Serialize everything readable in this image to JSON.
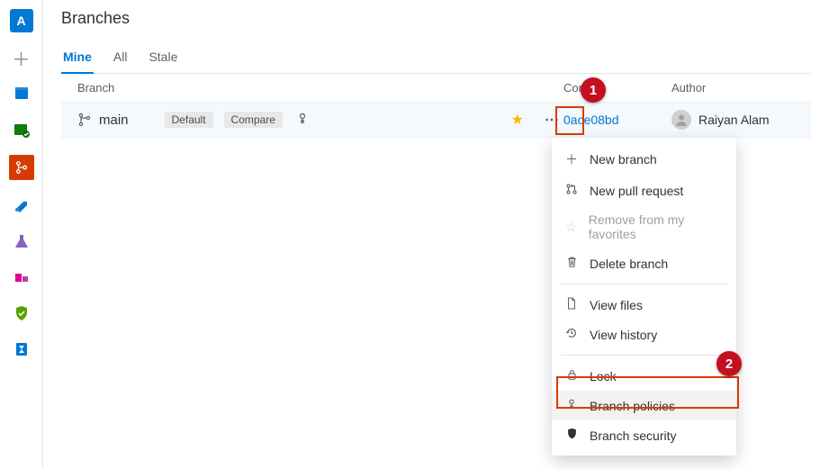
{
  "page": {
    "title": "Branches"
  },
  "tabs": [
    {
      "label": "Mine",
      "active": true
    },
    {
      "label": "All",
      "active": false
    },
    {
      "label": "Stale",
      "active": false
    }
  ],
  "columns": {
    "branch": "Branch",
    "commit": "Commit",
    "author": "Author"
  },
  "row": {
    "branch_name": "main",
    "badge_default": "Default",
    "badge_compare": "Compare",
    "commit_hash": "0ace08bd",
    "author_name": "Raiyan Alam"
  },
  "menu": {
    "new_branch": "New branch",
    "new_pr": "New pull request",
    "remove_fav": "Remove from my favorites",
    "delete_branch": "Delete branch",
    "view_files": "View files",
    "view_history": "View history",
    "lock": "Lock",
    "branch_policies": "Branch policies",
    "branch_security": "Branch security"
  },
  "callouts": {
    "one": "1",
    "two": "2"
  },
  "leftnav": {
    "project_letter": "A"
  }
}
